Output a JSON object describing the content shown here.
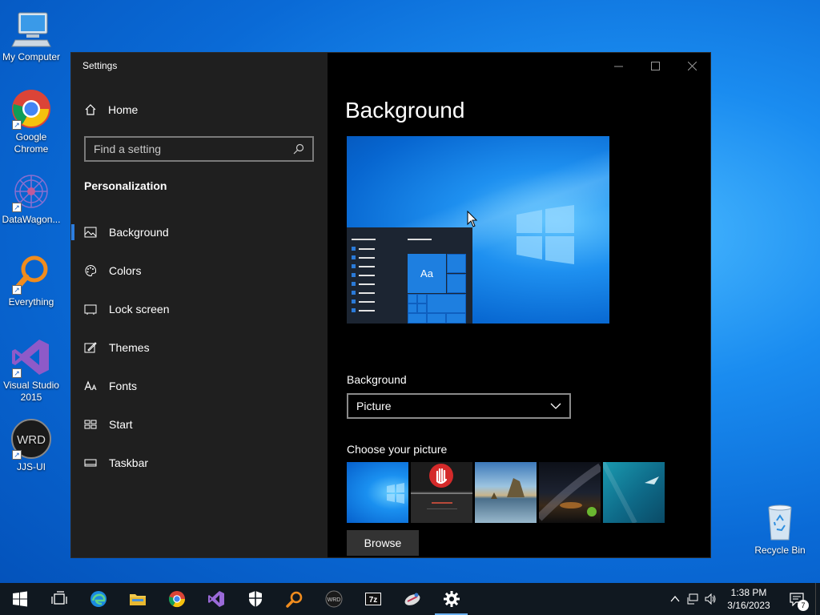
{
  "desktop": {
    "icons": [
      {
        "label": "My Computer"
      },
      {
        "label": "Google Chrome"
      },
      {
        "label": "DataWagon..."
      },
      {
        "label": "Everything"
      },
      {
        "label": "Visual Studio 2015"
      },
      {
        "label": "JJS-UI"
      }
    ],
    "recycle_bin": "Recycle Bin",
    "logo_text": "WRD"
  },
  "window": {
    "title": "Settings",
    "nav": {
      "home": "Home",
      "search_placeholder": "Find a setting",
      "section": "Personalization",
      "items": [
        {
          "label": "Background",
          "icon": "picture-icon",
          "selected": true
        },
        {
          "label": "Colors",
          "icon": "palette-icon"
        },
        {
          "label": "Lock screen",
          "icon": "lock-screen-icon"
        },
        {
          "label": "Themes",
          "icon": "themes-icon"
        },
        {
          "label": "Fonts",
          "icon": "fonts-icon"
        },
        {
          "label": "Start",
          "icon": "start-icon"
        },
        {
          "label": "Taskbar",
          "icon": "taskbar-icon"
        }
      ]
    },
    "content": {
      "title": "Background",
      "preview_tile_text": "Aa",
      "background_label": "Background",
      "background_value": "Picture",
      "choose_label": "Choose your picture",
      "browse_label": "Browse"
    }
  },
  "taskbar": {
    "apps": [
      "start-icon",
      "task-view-icon",
      "edge-icon",
      "file-explorer-icon",
      "chrome-icon",
      "visual-studio-icon",
      "security-icon",
      "everything-icon",
      "jjs-ui-icon",
      "7zip-icon",
      "datawagon-icon",
      "settings-icon"
    ],
    "zip_label": "7z",
    "time": "1:38 PM",
    "date": "3/16/2023",
    "notification_count": "7"
  },
  "colors": {
    "accent": "#2b7de0",
    "nav_bg": "#1f1f1f",
    "content_bg": "#000000"
  }
}
